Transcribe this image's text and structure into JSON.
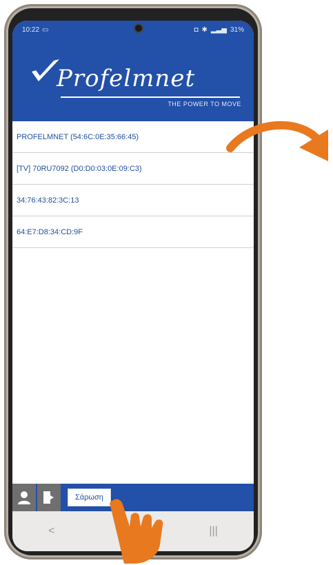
{
  "status_bar": {
    "time": "10:22",
    "battery": "31%"
  },
  "app": {
    "logo_text": "Profelmnet",
    "tagline": "THE POWER TO MOVE"
  },
  "devices": [
    {
      "label": "PROFELMNET (54:6C:0E:35:66:45)"
    },
    {
      "label": "[TV] 70RU7092 (D0:D0:03:0E:09:C3)"
    },
    {
      "label": "34:76:43:82:3C:13"
    },
    {
      "label": "64:E7:D8:34:CD:9F"
    }
  ],
  "toolbar": {
    "scan_label": "Σάρωση"
  },
  "nav": {
    "back_glyph": "<",
    "recents_glyph": "|||"
  },
  "colors": {
    "brand_blue": "#2350a8",
    "annotation_orange": "#e8791f"
  },
  "icons": {
    "user": "user-icon",
    "exit": "exit-icon"
  }
}
